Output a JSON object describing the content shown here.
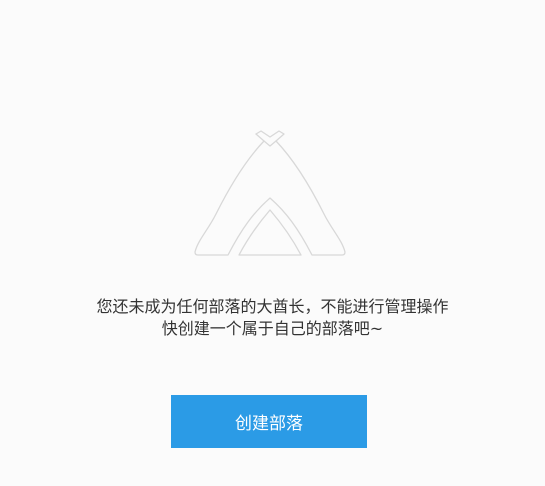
{
  "empty_state": {
    "icon": "tent-icon",
    "message_line1": "您还未成为任何部落的大酋长，不能进行管理操作",
    "message_line2": "快创建一个属于自己的部落吧~"
  },
  "actions": {
    "create_label": "创建部落"
  },
  "colors": {
    "background": "#fbfbfb",
    "primary_button": "#2b9be6",
    "icon_stroke": "#d8d8d8",
    "text": "#333333"
  }
}
